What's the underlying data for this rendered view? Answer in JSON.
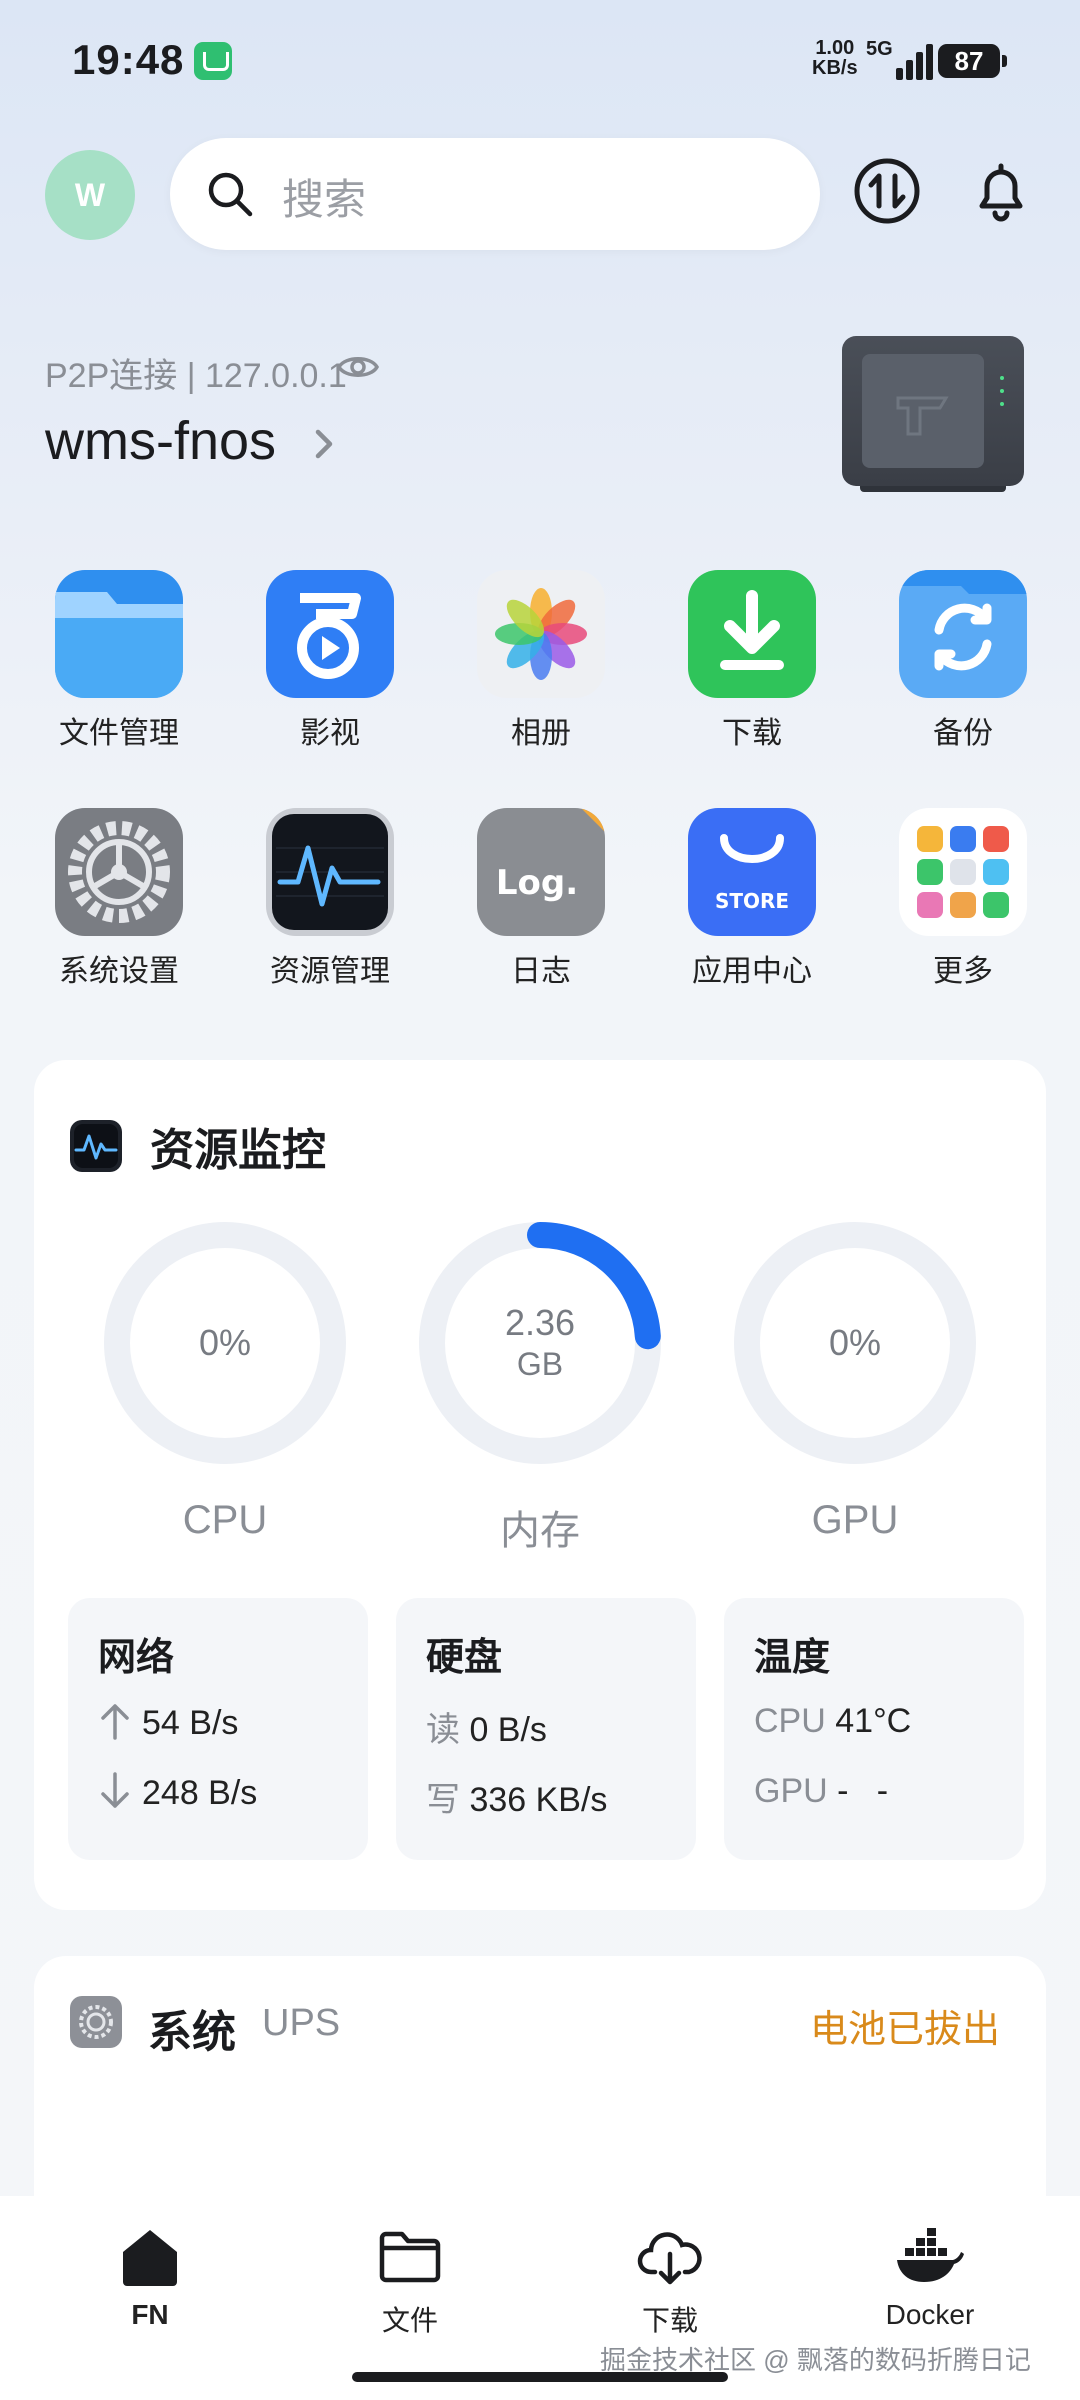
{
  "status_bar": {
    "time": "19:48",
    "net_speed_value": "1.00",
    "net_speed_unit": "KB/s",
    "network": "5G",
    "battery": "87"
  },
  "header": {
    "avatar_letter": "W",
    "search_placeholder": "搜索"
  },
  "device": {
    "connection": "P2P连接 | 127.0.0.1",
    "name": "wms-fnos"
  },
  "apps": [
    {
      "label": "文件管理",
      "icon": "folder-icon",
      "color": "#3aa0f2"
    },
    {
      "label": "影视",
      "icon": "film-icon",
      "color": "#2f7ef5"
    },
    {
      "label": "相册",
      "icon": "photos-icon",
      "color": "#f0f2f5"
    },
    {
      "label": "下载",
      "icon": "download-icon",
      "color": "#31c85b"
    },
    {
      "label": "备份",
      "icon": "backup-icon",
      "color": "#5aaaf5"
    },
    {
      "label": "系统设置",
      "icon": "gear-icon",
      "color": "#6b6e74"
    },
    {
      "label": "资源管理",
      "icon": "monitor-icon",
      "color": "#1d2129"
    },
    {
      "label": "日志",
      "icon": "log-icon",
      "color": "#7a7d82"
    },
    {
      "label": "应用中心",
      "icon": "store-icon",
      "color": "#3a6ef5"
    },
    {
      "label": "更多",
      "icon": "more-icon",
      "color": "#ffffff"
    }
  ],
  "store_text": "STORE",
  "log_text": "Log.",
  "monitor": {
    "title": "资源监控",
    "cpu": {
      "value": "0%",
      "label": "CPU",
      "percent": 0
    },
    "memory": {
      "value": "2.36",
      "unit": "GB",
      "label": "内存",
      "percent": 24
    },
    "gpu": {
      "value": "0%",
      "label": "GPU",
      "percent": 0
    },
    "accent_color": "#1f6ff2",
    "network": {
      "title": "网络",
      "up": "54 B/s",
      "down": "248 B/s"
    },
    "disk": {
      "title": "硬盘",
      "read_label": "读",
      "read": "0 B/s",
      "write_label": "写",
      "write": "336 KB/s"
    },
    "temperature": {
      "title": "温度",
      "cpu_label": "CPU",
      "cpu": "41°C",
      "gpu_label": "GPU",
      "gpu": "-   -"
    }
  },
  "system_card": {
    "title": "系统",
    "subtitle": "UPS",
    "status": "电池已拔出",
    "status_color": "#d98a1b"
  },
  "bottom_nav": [
    {
      "label": "FN",
      "icon": "home-icon"
    },
    {
      "label": "文件",
      "icon": "folder-icon"
    },
    {
      "label": "下载",
      "icon": "download-icon"
    },
    {
      "label": "Docker",
      "icon": "docker-icon"
    }
  ],
  "watermark": "掘金技术社区 @ 飘落的数码折腾日记"
}
